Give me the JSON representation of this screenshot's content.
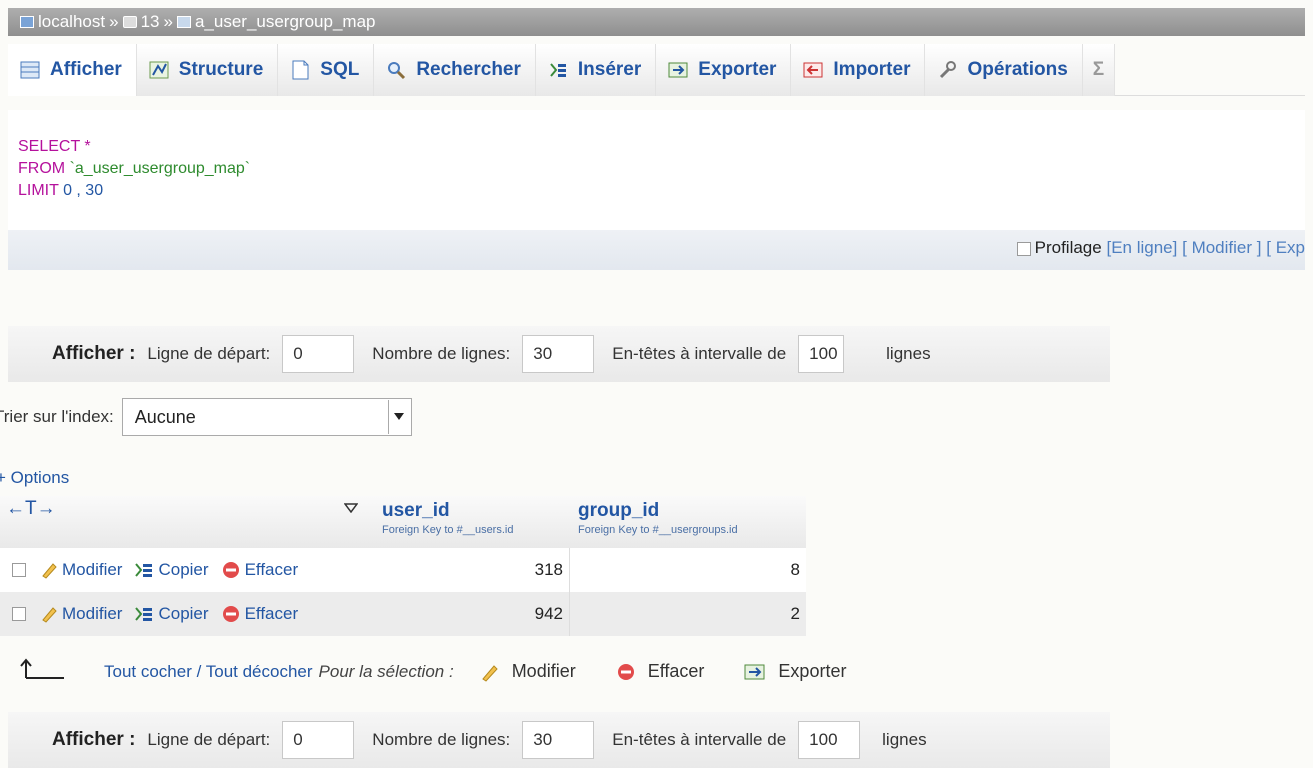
{
  "breadcrumb": {
    "server": "localhost",
    "sep1": "»",
    "database": "13",
    "sep2": "»",
    "table": "a_user_usergroup_map"
  },
  "tabs": [
    {
      "label": "Afficher",
      "icon": "browse-icon"
    },
    {
      "label": "Structure",
      "icon": "structure-icon"
    },
    {
      "label": "SQL",
      "icon": "sql-icon"
    },
    {
      "label": "Rechercher",
      "icon": "search-icon"
    },
    {
      "label": "Insérer",
      "icon": "insert-icon"
    },
    {
      "label": "Exporter",
      "icon": "export-icon"
    },
    {
      "label": "Importer",
      "icon": "import-icon"
    },
    {
      "label": "Opérations",
      "icon": "operations-icon"
    },
    {
      "label": "Σ",
      "icon": "more-icon"
    }
  ],
  "sql": {
    "select_kw": "SELECT",
    "star": "*",
    "from_kw": "FROM",
    "table": "`a_user_usergroup_map`",
    "limit_kw": "LIMIT",
    "limit_value": "0 , 30"
  },
  "profiling": {
    "label": "Profilage",
    "inline_link": "En ligne",
    "edit_link": "Modifier",
    "explain_link": "Exp"
  },
  "nav": {
    "show_label": "Afficher :",
    "start_label": "Ligne de départ:",
    "start_value": "0",
    "rows_label": "Nombre de lignes:",
    "rows_value": "30",
    "headers_label": "En-têtes à intervalle de",
    "headers_value": "100",
    "lines_label": "lignes"
  },
  "sort": {
    "label": "Trier sur l'index:",
    "selected": "Aucune"
  },
  "options_label": "+ Options",
  "table": {
    "arrows": "←T→",
    "columns": [
      {
        "name": "user_id",
        "fk": "Foreign Key to #__users.id"
      },
      {
        "name": "group_id",
        "fk": "Foreign Key to #__usergroups.id"
      }
    ],
    "row_actions": {
      "edit": "Modifier",
      "copy": "Copier",
      "delete": "Effacer"
    },
    "rows": [
      {
        "user_id": "318",
        "group_id": "8"
      },
      {
        "user_id": "942",
        "group_id": "2"
      }
    ]
  },
  "bulk": {
    "select_all": "Tout cocher / Tout décocher",
    "for_selection": "Pour la sélection :",
    "edit": "Modifier",
    "delete": "Effacer",
    "export": "Exporter"
  },
  "colors": {
    "link": "#2356a3",
    "keyword": "#b5119c",
    "string": "#2e8b2e"
  }
}
